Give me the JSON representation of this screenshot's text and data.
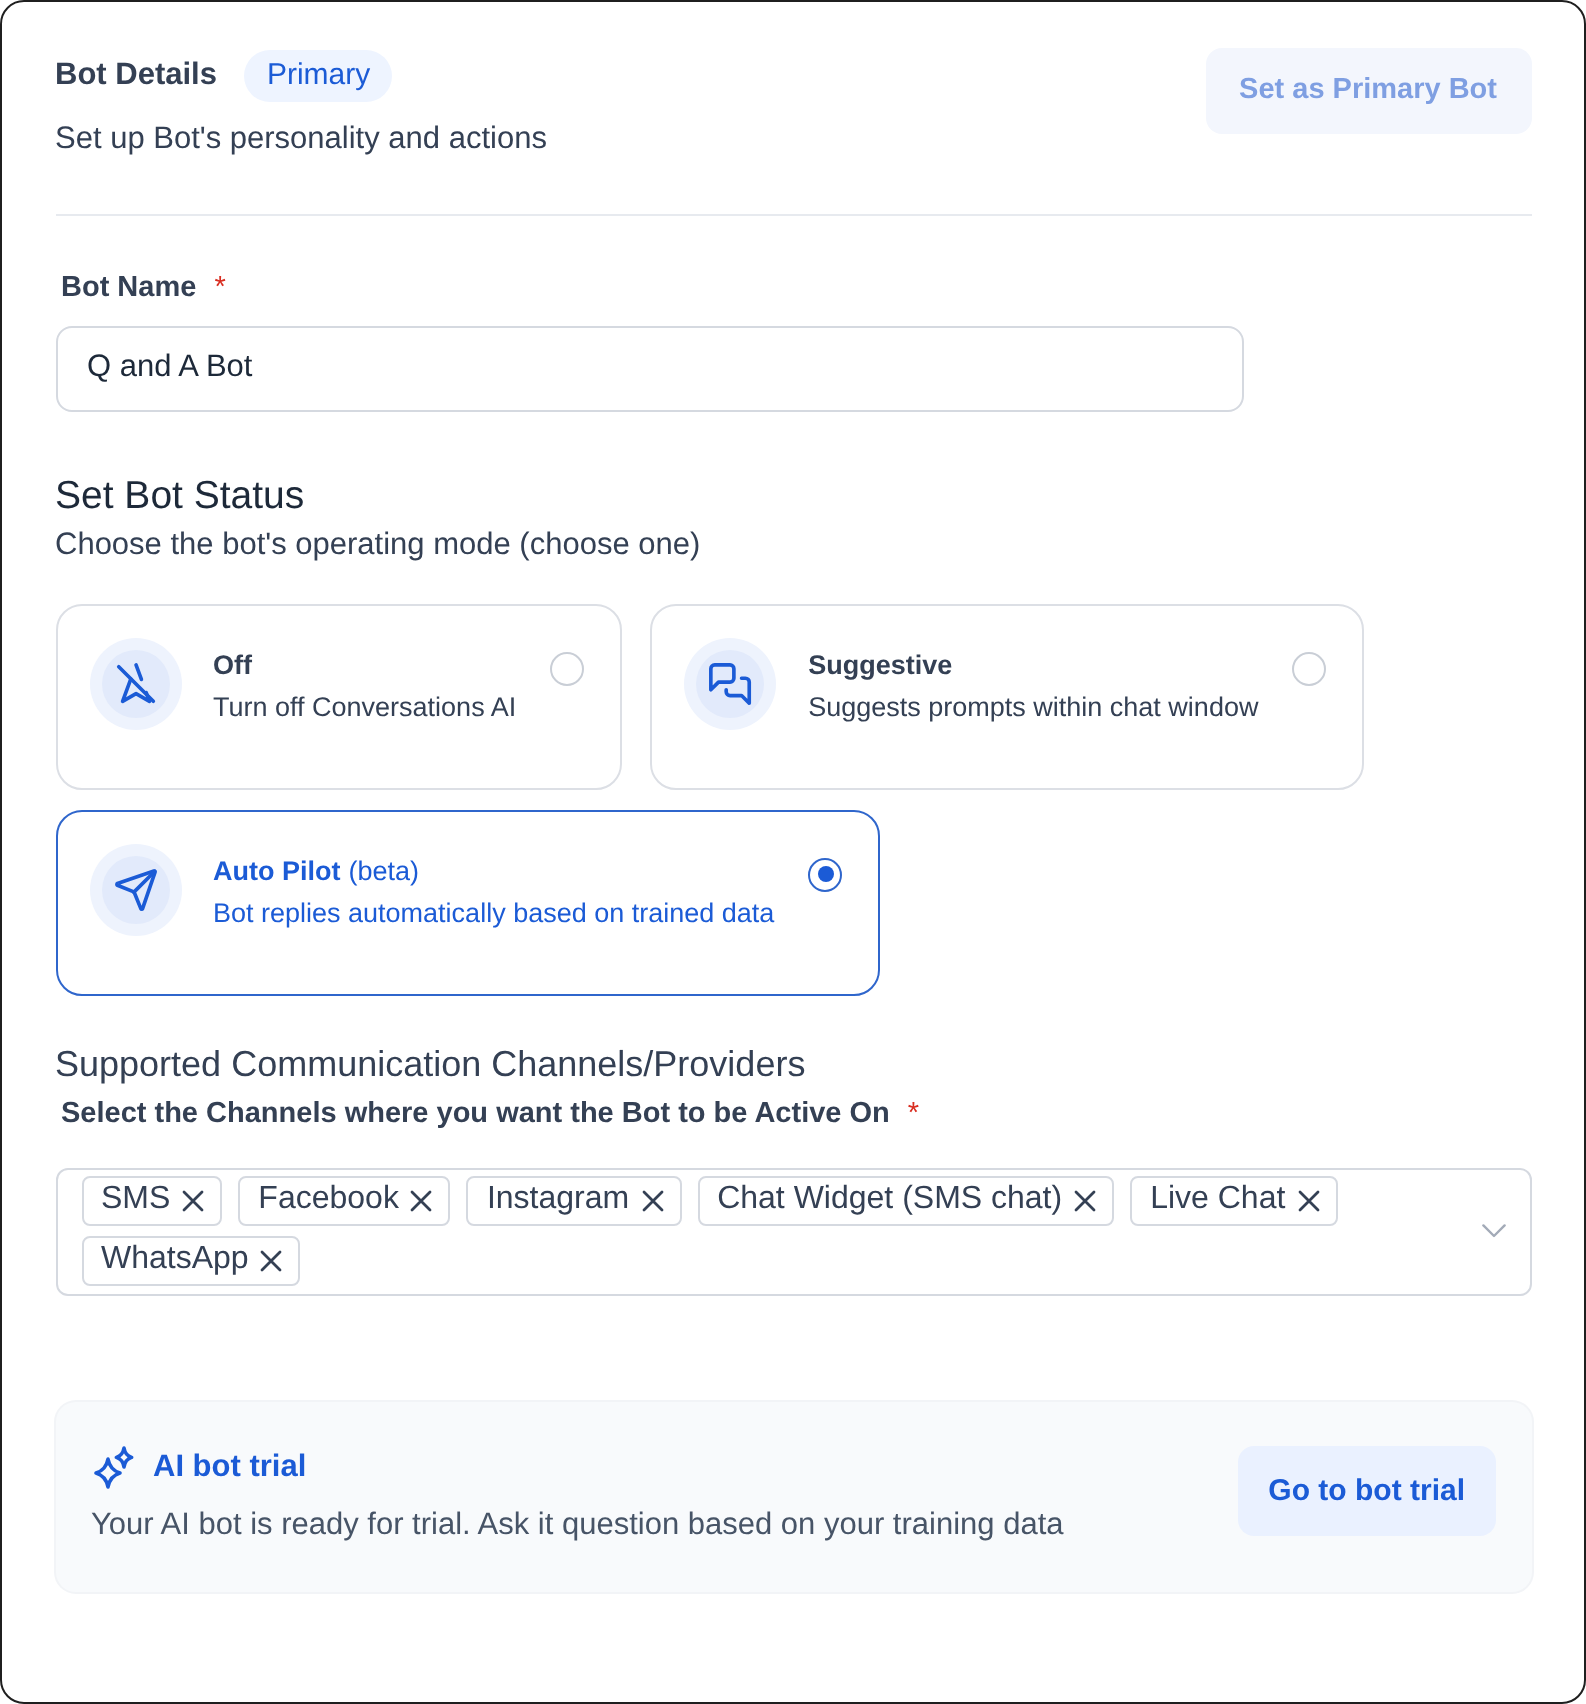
{
  "header": {
    "title": "Bot Details",
    "badge": "Primary",
    "subtitle": "Set up Bot's personality and actions",
    "button": {
      "label": "Set as Primary Bot",
      "disabled": true
    }
  },
  "bot_name": {
    "label": "Bot Name",
    "required_mark": "*",
    "value": "Q and A Bot"
  },
  "bot_status": {
    "title": "Set Bot Status",
    "subtitle": "Choose the bot's operating mode (choose one)",
    "options": [
      {
        "kind": "off",
        "title": "Off",
        "description": "Turn off Conversations AI",
        "selected": false
      },
      {
        "kind": "suggestive",
        "title": "Suggestive",
        "description": "Suggests prompts within chat window",
        "selected": false
      },
      {
        "kind": "autopilot",
        "title": "Auto Pilot",
        "note": "(beta)",
        "description": "Bot replies automatically based on trained data",
        "selected": true
      }
    ]
  },
  "channels": {
    "title": "Supported Communication Channels/Providers",
    "label": "Select the Channels where you want the Bot to be Active On",
    "required_mark": "*",
    "tags": [
      "SMS",
      "Facebook",
      "Instagram",
      "Chat Widget (SMS chat)",
      "Live Chat",
      "WhatsApp"
    ]
  },
  "trial": {
    "title": "AI bot trial",
    "description": "Your AI bot is ready for trial. Ask it question based on your training data",
    "button": "Go to bot trial"
  }
}
